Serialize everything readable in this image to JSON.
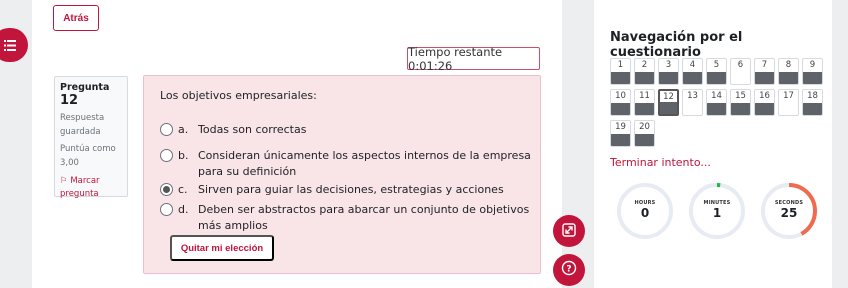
{
  "header": {
    "back_label": "Atrás"
  },
  "timer": {
    "text": "Tiempo restante 0:01:26"
  },
  "question_info": {
    "label": "Pregunta",
    "number": "12",
    "status": "Respuesta guardada",
    "grade": "Puntúa como 3,00",
    "flag_label": "Marcar pregunta"
  },
  "question": {
    "text": "Los objetivos empresariales:",
    "options": [
      {
        "letter": "a.",
        "text": "Todas son correctas",
        "selected": false
      },
      {
        "letter": "b.",
        "text": "Consideran únicamente los aspectos internos de la empresa para su definición",
        "selected": false
      },
      {
        "letter": "c.",
        "text": "Sirven para guiar las decisiones, estrategias y acciones",
        "selected": true
      },
      {
        "letter": "d.",
        "text": "Deben ser abstractos para abarcar un conjunto de objetivos más amplios",
        "selected": false
      }
    ],
    "clear_label": "Quitar mi elección"
  },
  "navigation": {
    "title": "Navegación por el cuestionario",
    "questions": [
      {
        "n": "1",
        "state": "answered"
      },
      {
        "n": "2",
        "state": "answered"
      },
      {
        "n": "3",
        "state": "answered"
      },
      {
        "n": "4",
        "state": "answered"
      },
      {
        "n": "5",
        "state": "answered"
      },
      {
        "n": "6",
        "state": "unanswered"
      },
      {
        "n": "7",
        "state": "answered"
      },
      {
        "n": "8",
        "state": "answered"
      },
      {
        "n": "9",
        "state": "answered"
      },
      {
        "n": "10",
        "state": "answered"
      },
      {
        "n": "11",
        "state": "answered"
      },
      {
        "n": "12",
        "state": "current"
      },
      {
        "n": "13",
        "state": "unanswered"
      },
      {
        "n": "14",
        "state": "answered"
      },
      {
        "n": "15",
        "state": "answered"
      },
      {
        "n": "16",
        "state": "answered"
      },
      {
        "n": "17",
        "state": "unanswered"
      },
      {
        "n": "18",
        "state": "answered"
      },
      {
        "n": "19",
        "state": "answered"
      },
      {
        "n": "20",
        "state": "answered"
      }
    ],
    "finish_label": "Terminar intento..."
  },
  "countdown": [
    {
      "label": "HOURS",
      "value": "0",
      "fraction": 0,
      "color": "#4caf50"
    },
    {
      "label": "MINUTES",
      "value": "1",
      "fraction": 0.02,
      "color": "#1fb94a"
    },
    {
      "label": "SECONDS",
      "value": "25",
      "fraction": 0.42,
      "color": "#f06a4f"
    }
  ],
  "colors": {
    "accent": "#c2153b",
    "track": "#e7ebf4"
  },
  "icons": [
    "list-icon",
    "fullscreen-icon",
    "help-icon"
  ]
}
